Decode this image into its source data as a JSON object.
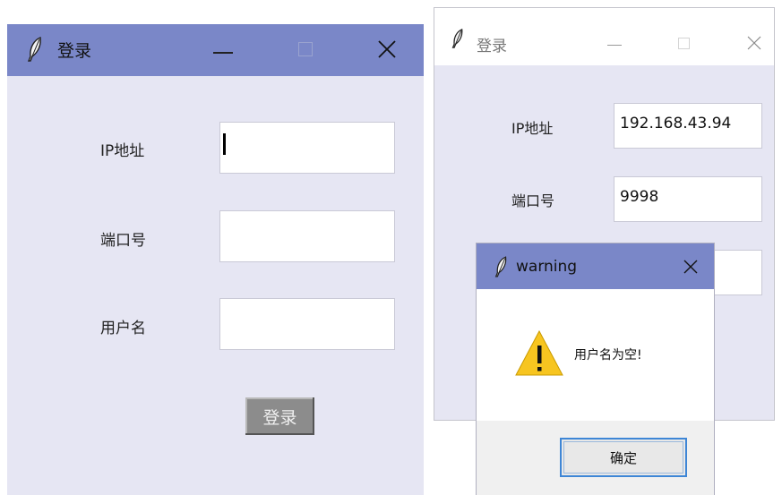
{
  "login_window": {
    "title": "登录",
    "labels": {
      "ip": "IP地址",
      "port": "端口号",
      "username": "用户名"
    },
    "fields": {
      "ip": "",
      "port": "",
      "username": ""
    },
    "login_button": "登录"
  },
  "login_window_2": {
    "title": "登录",
    "labels": {
      "ip": "IP地址",
      "port": "端口号"
    },
    "fields": {
      "ip": "192.168.43.94",
      "port": "9998",
      "username": ""
    }
  },
  "warning_dialog": {
    "title": "warning",
    "message": "用户名为空!",
    "ok_button": "确定"
  },
  "icons": {
    "app": "feather-icon",
    "minimize": "minimize-icon",
    "maximize": "maximize-icon",
    "close": "close-icon",
    "warning": "warning-icon"
  },
  "colors": {
    "titlebar_active": "#7a87c8",
    "window_bg": "#e6e6f3",
    "focus_border": "#3e86d6",
    "warning_yellow": "#f7c520"
  }
}
